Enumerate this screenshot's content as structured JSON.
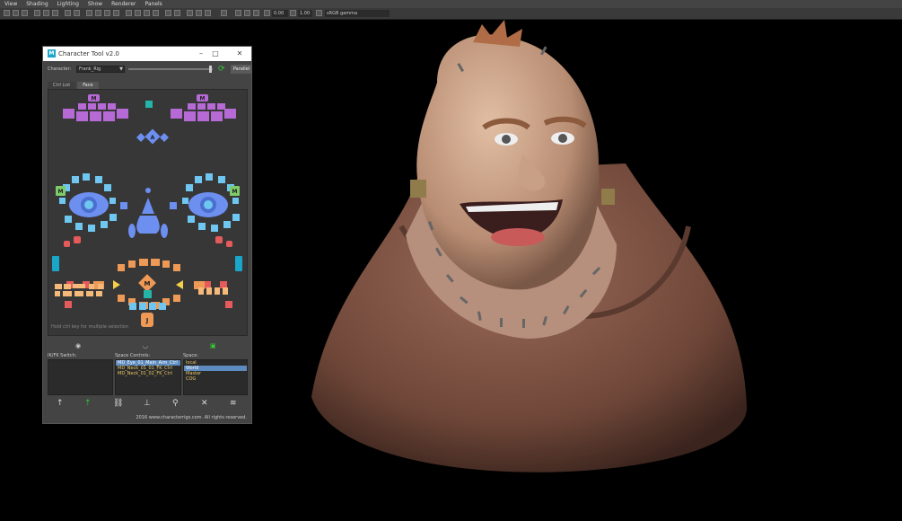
{
  "menubar": [
    "View",
    "Shading",
    "Lighting",
    "Show",
    "Renderer",
    "Panels"
  ],
  "toolbar": {
    "field_a": "0.00",
    "field_b": "1.00",
    "colorspace": "sRGB gamma"
  },
  "window": {
    "title": "Character Tool v2.0",
    "character_label": "Character:",
    "character_value": "Frank_Rig",
    "parallel_label": "Parallel",
    "tabs": [
      "Ctrl List",
      "Face"
    ],
    "active_tab": "Face",
    "face_labels": {
      "m": "M",
      "a": "A",
      "j": "J"
    },
    "hint": "Hold ctrl key for multiple selection",
    "ikfk_label": "IK/FK Switch:",
    "space_controls_label": "Space Controls:",
    "space_label": "Space:",
    "space_controls": [
      "MD_Eye_01_Main_Aim_Ctrl",
      "MD_Neck_01_01_FK_Ctrl",
      "MD_Neck_01_02_FK_Ctrl"
    ],
    "spaces": [
      "local",
      "World",
      "Master",
      "COG"
    ],
    "selected_space": "World",
    "copyright": "2016 www.characterrigs.com. All rights reserved."
  },
  "colors": {
    "accent": "#1aa6c9",
    "purple": "#b66ad6",
    "blue": "#6c8ff0",
    "lightblue": "#6fc6f0",
    "green": "#7ecb6a",
    "teal": "#23b5a8",
    "red": "#e55a5a",
    "orange": "#ee9a56",
    "peach": "#f5b97a",
    "yellow": "#f5d04a"
  }
}
